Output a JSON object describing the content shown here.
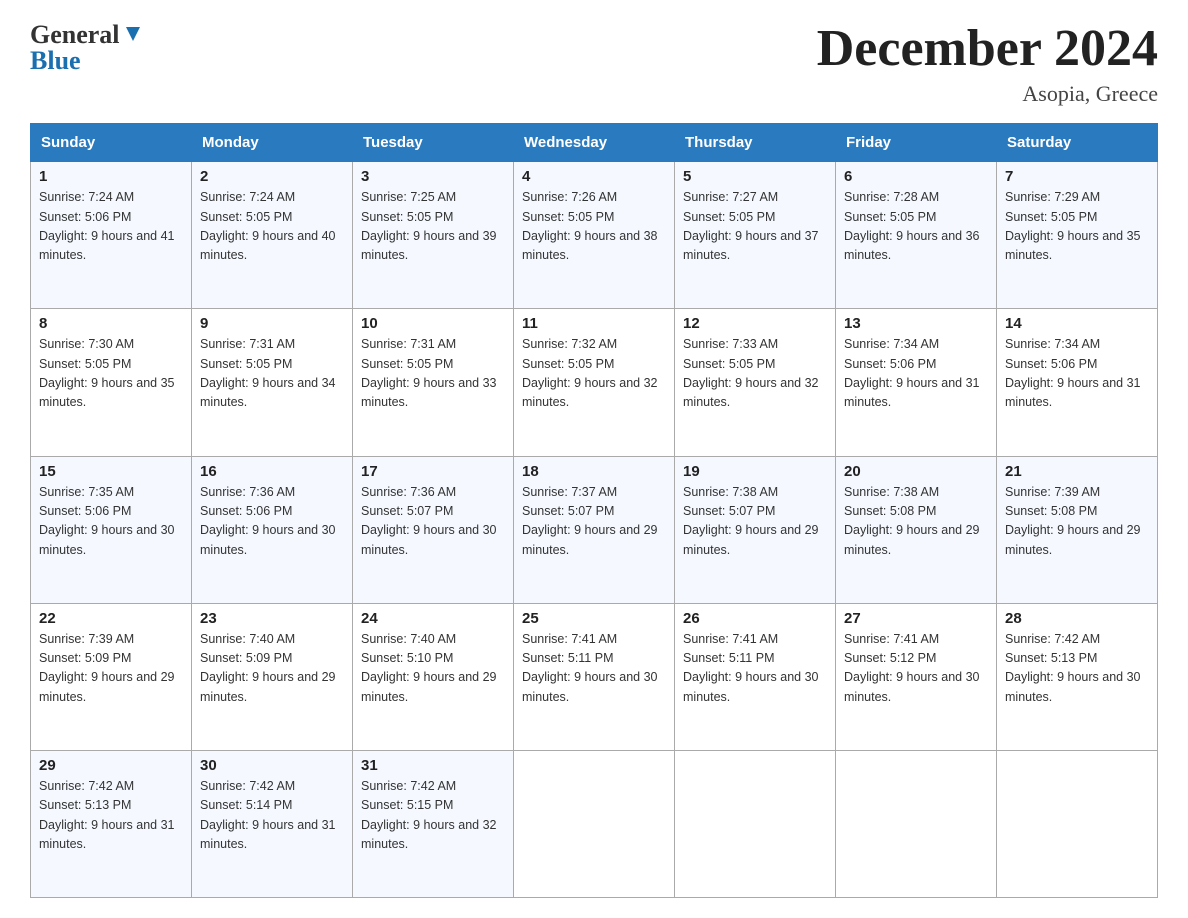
{
  "logo": {
    "general": "General",
    "blue": "Blue"
  },
  "header": {
    "month": "December 2024",
    "location": "Asopia, Greece"
  },
  "days_of_week": [
    "Sunday",
    "Monday",
    "Tuesday",
    "Wednesday",
    "Thursday",
    "Friday",
    "Saturday"
  ],
  "weeks": [
    [
      {
        "day": "1",
        "sunrise": "7:24 AM",
        "sunset": "5:06 PM",
        "daylight": "9 hours and 41 minutes."
      },
      {
        "day": "2",
        "sunrise": "7:24 AM",
        "sunset": "5:05 PM",
        "daylight": "9 hours and 40 minutes."
      },
      {
        "day": "3",
        "sunrise": "7:25 AM",
        "sunset": "5:05 PM",
        "daylight": "9 hours and 39 minutes."
      },
      {
        "day": "4",
        "sunrise": "7:26 AM",
        "sunset": "5:05 PM",
        "daylight": "9 hours and 38 minutes."
      },
      {
        "day": "5",
        "sunrise": "7:27 AM",
        "sunset": "5:05 PM",
        "daylight": "9 hours and 37 minutes."
      },
      {
        "day": "6",
        "sunrise": "7:28 AM",
        "sunset": "5:05 PM",
        "daylight": "9 hours and 36 minutes."
      },
      {
        "day": "7",
        "sunrise": "7:29 AM",
        "sunset": "5:05 PM",
        "daylight": "9 hours and 35 minutes."
      }
    ],
    [
      {
        "day": "8",
        "sunrise": "7:30 AM",
        "sunset": "5:05 PM",
        "daylight": "9 hours and 35 minutes."
      },
      {
        "day": "9",
        "sunrise": "7:31 AM",
        "sunset": "5:05 PM",
        "daylight": "9 hours and 34 minutes."
      },
      {
        "day": "10",
        "sunrise": "7:31 AM",
        "sunset": "5:05 PM",
        "daylight": "9 hours and 33 minutes."
      },
      {
        "day": "11",
        "sunrise": "7:32 AM",
        "sunset": "5:05 PM",
        "daylight": "9 hours and 32 minutes."
      },
      {
        "day": "12",
        "sunrise": "7:33 AM",
        "sunset": "5:05 PM",
        "daylight": "9 hours and 32 minutes."
      },
      {
        "day": "13",
        "sunrise": "7:34 AM",
        "sunset": "5:06 PM",
        "daylight": "9 hours and 31 minutes."
      },
      {
        "day": "14",
        "sunrise": "7:34 AM",
        "sunset": "5:06 PM",
        "daylight": "9 hours and 31 minutes."
      }
    ],
    [
      {
        "day": "15",
        "sunrise": "7:35 AM",
        "sunset": "5:06 PM",
        "daylight": "9 hours and 30 minutes."
      },
      {
        "day": "16",
        "sunrise": "7:36 AM",
        "sunset": "5:06 PM",
        "daylight": "9 hours and 30 minutes."
      },
      {
        "day": "17",
        "sunrise": "7:36 AM",
        "sunset": "5:07 PM",
        "daylight": "9 hours and 30 minutes."
      },
      {
        "day": "18",
        "sunrise": "7:37 AM",
        "sunset": "5:07 PM",
        "daylight": "9 hours and 29 minutes."
      },
      {
        "day": "19",
        "sunrise": "7:38 AM",
        "sunset": "5:07 PM",
        "daylight": "9 hours and 29 minutes."
      },
      {
        "day": "20",
        "sunrise": "7:38 AM",
        "sunset": "5:08 PM",
        "daylight": "9 hours and 29 minutes."
      },
      {
        "day": "21",
        "sunrise": "7:39 AM",
        "sunset": "5:08 PM",
        "daylight": "9 hours and 29 minutes."
      }
    ],
    [
      {
        "day": "22",
        "sunrise": "7:39 AM",
        "sunset": "5:09 PM",
        "daylight": "9 hours and 29 minutes."
      },
      {
        "day": "23",
        "sunrise": "7:40 AM",
        "sunset": "5:09 PM",
        "daylight": "9 hours and 29 minutes."
      },
      {
        "day": "24",
        "sunrise": "7:40 AM",
        "sunset": "5:10 PM",
        "daylight": "9 hours and 29 minutes."
      },
      {
        "day": "25",
        "sunrise": "7:41 AM",
        "sunset": "5:11 PM",
        "daylight": "9 hours and 30 minutes."
      },
      {
        "day": "26",
        "sunrise": "7:41 AM",
        "sunset": "5:11 PM",
        "daylight": "9 hours and 30 minutes."
      },
      {
        "day": "27",
        "sunrise": "7:41 AM",
        "sunset": "5:12 PM",
        "daylight": "9 hours and 30 minutes."
      },
      {
        "day": "28",
        "sunrise": "7:42 AM",
        "sunset": "5:13 PM",
        "daylight": "9 hours and 30 minutes."
      }
    ],
    [
      {
        "day": "29",
        "sunrise": "7:42 AM",
        "sunset": "5:13 PM",
        "daylight": "9 hours and 31 minutes."
      },
      {
        "day": "30",
        "sunrise": "7:42 AM",
        "sunset": "5:14 PM",
        "daylight": "9 hours and 31 minutes."
      },
      {
        "day": "31",
        "sunrise": "7:42 AM",
        "sunset": "5:15 PM",
        "daylight": "9 hours and 32 minutes."
      },
      null,
      null,
      null,
      null
    ]
  ],
  "labels": {
    "sunrise": "Sunrise:",
    "sunset": "Sunset:",
    "daylight": "Daylight:"
  }
}
